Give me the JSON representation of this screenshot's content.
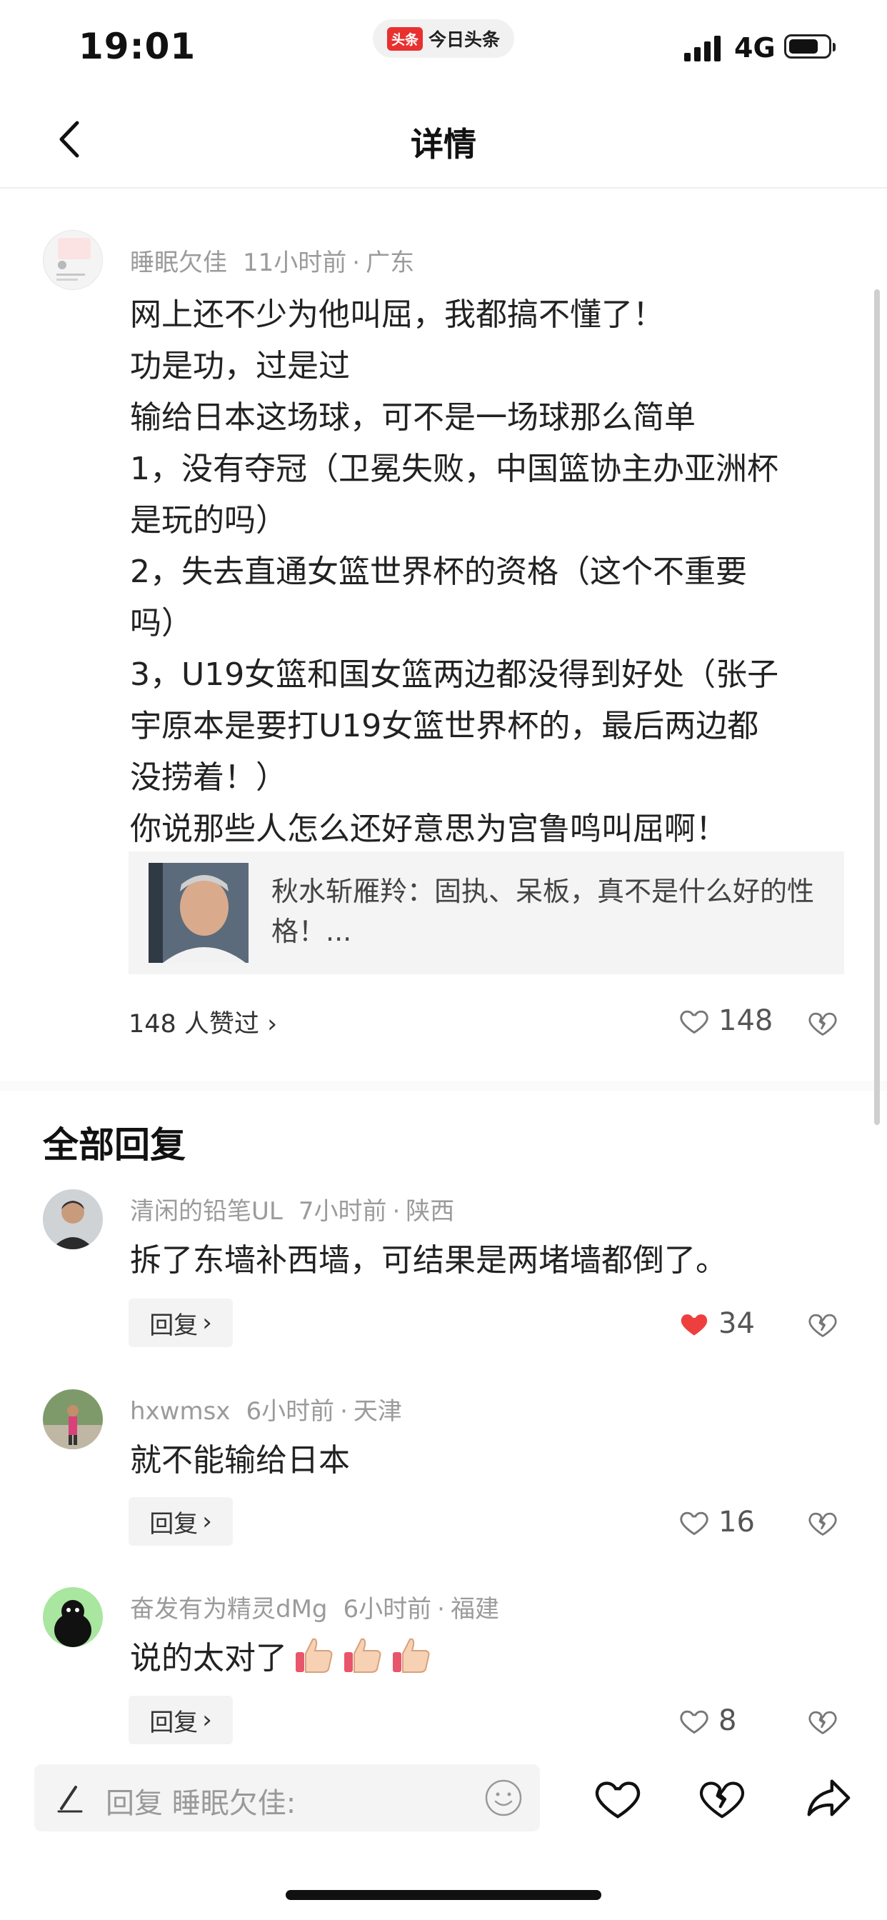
{
  "status_bar": {
    "time": "19:01",
    "app_badge_logo": "头条",
    "app_badge_name": "今日头条",
    "network": "4G"
  },
  "nav": {
    "title": "详情",
    "back_icon": "chevron-left-icon"
  },
  "main_comment": {
    "author": "睡眠欠佳",
    "time": "11小时前",
    "location": "广东",
    "lines": [
      "网上还不少为他叫屈，我都搞不懂了！",
      "功是功，过是过",
      "输给日本这场球，可不是一场球那么简单",
      "1，没有夺冠（卫冕失败，中国篮协主办亚洲杯",
      "是玩的吗）",
      "2，失去直通女篮世界杯的资格（这个不重要",
      "吗）",
      "3，U19女篮和国女篮两边都没得到好处（张子",
      "宇原本是要打U19女篮世界杯的，最后两边都",
      "没捞着！）",
      "你说那些人怎么还好意思为宫鲁鸣叫屈啊！"
    ],
    "quote": {
      "text": "秋水斩雁羚：固执、呆板，真不是什么好的性格！..."
    },
    "likers_text": "148 人赞过",
    "like_count": "148"
  },
  "replies_section": {
    "title": "全部回复",
    "reply_button_label": "回复",
    "items": [
      {
        "author": "清闲的铅笔UL",
        "time": "7小时前",
        "location": "陕西",
        "text": "拆了东墙补西墙，可结果是两堵墙都倒了。",
        "likes": "34",
        "liked": true
      },
      {
        "author": "hxwmsx",
        "time": "6小时前",
        "location": "天津",
        "text": "就不能输给日本",
        "likes": "16",
        "liked": false
      },
      {
        "author": "奋发有为精灵dMg",
        "time": "6小时前",
        "location": "福建",
        "text": "说的太对了",
        "likes": "8",
        "liked": false
      }
    ]
  },
  "bottom_bar": {
    "input_placeholder": "回复 睡眠欠佳:",
    "icons": [
      "pen-icon",
      "emoji-icon",
      "heart-icon",
      "dislike-icon",
      "share-icon"
    ]
  },
  "colors": {
    "like_red": "#ee3f3f",
    "brand_red": "#e8312f",
    "meta_gray": "#9b9b9b"
  }
}
